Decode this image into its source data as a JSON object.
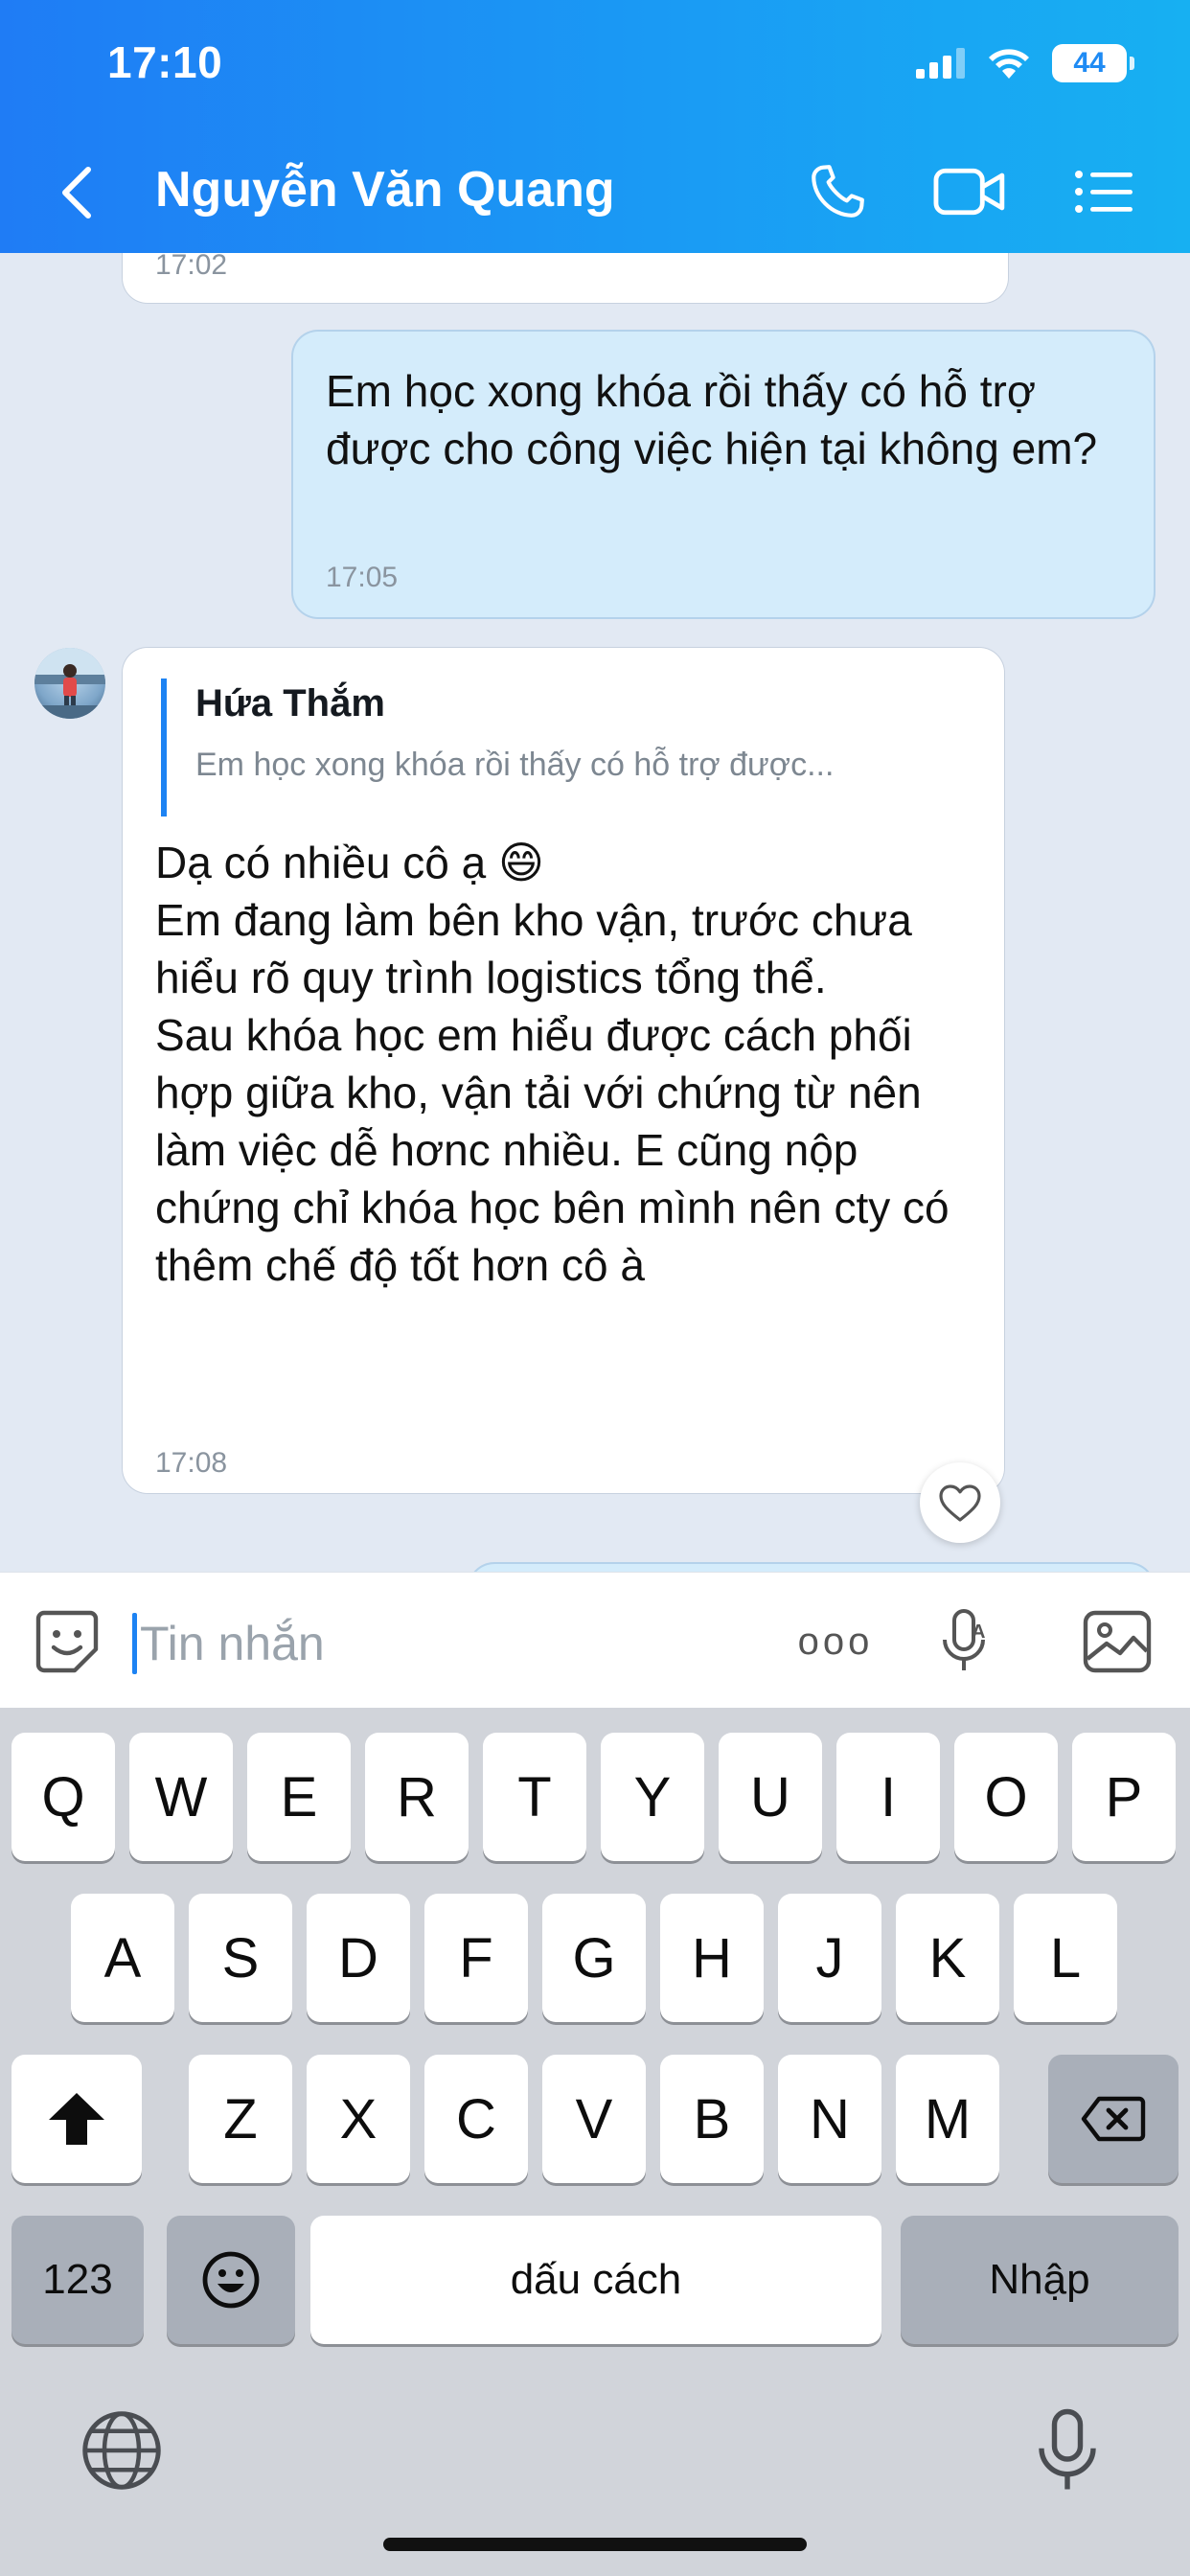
{
  "status_bar": {
    "time": "17:10",
    "battery": "44"
  },
  "header": {
    "title": "Nguyễn Văn Quang"
  },
  "messages": {
    "prev_time": "17:02",
    "sent": {
      "text": "Em học xong khóa rồi thấy có hỗ trợ được cho công việc hiện tại không em?",
      "time": "17:05"
    },
    "received": {
      "quote_name": "Hứa Thắm",
      "quote_text": "Em học xong khóa rồi thấy có hỗ trợ được...",
      "line1": "Dạ có nhiều cô ạ 😄",
      "line2": "Em đang làm bên kho vận, trước chưa hiểu rõ quy trình logistics tổng thể.",
      "line3": "Sau khóa học em hiểu được cách phối hợp giữa kho, vận tải với chứng từ nên làm việc dễ hơnc nhiều. E cũng nộp chứng chỉ khóa học bên mình nên cty có thêm chế độ tốt hơn cô à",
      "time": "17:08"
    }
  },
  "input": {
    "placeholder": "Tin nhắn",
    "more_label": "ooo"
  },
  "keyboard": {
    "row1": [
      "Q",
      "W",
      "E",
      "R",
      "T",
      "Y",
      "U",
      "I",
      "O",
      "P"
    ],
    "row2": [
      "A",
      "S",
      "D",
      "F",
      "G",
      "H",
      "J",
      "K",
      "L"
    ],
    "row3": [
      "Z",
      "X",
      "C",
      "V",
      "B",
      "N",
      "M"
    ],
    "numbers_label": "123",
    "space_label": "dấu cách",
    "return_label": "Nhập"
  },
  "colors": {
    "header_start": "#1f7cf5",
    "header_end": "#17b0f2",
    "sent_bubble": "#d4ecfb",
    "accent": "#1d83f3"
  }
}
